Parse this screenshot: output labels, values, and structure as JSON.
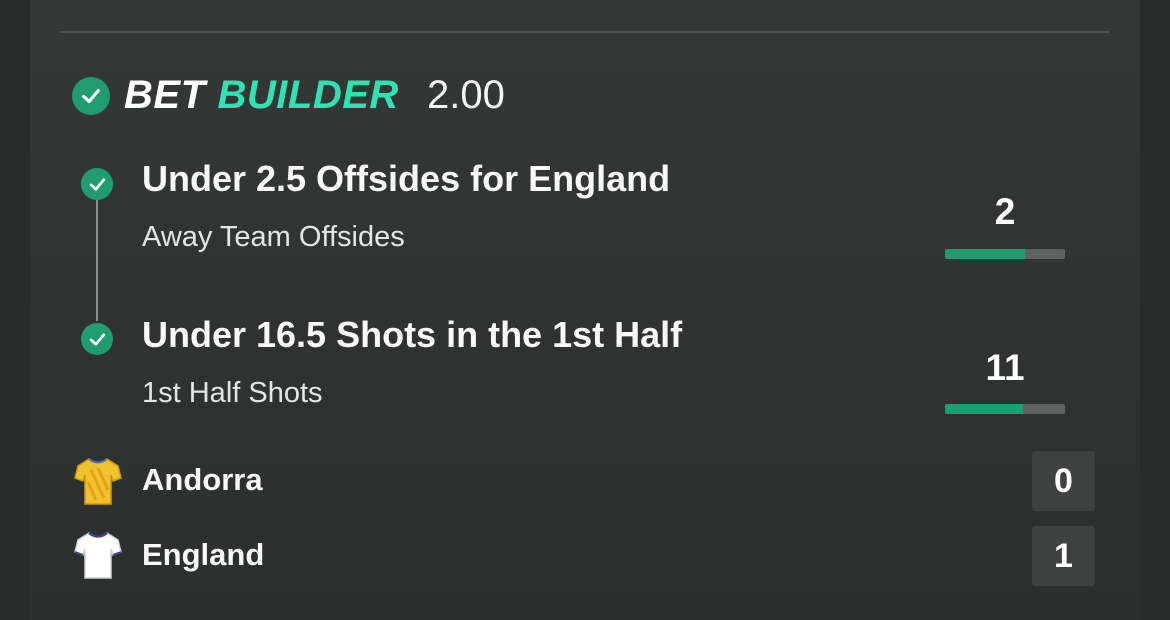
{
  "header": {
    "brand_word1": "BET",
    "brand_word2": "BUILDER",
    "odds": "2.00"
  },
  "selections": [
    {
      "title": "Under 2.5 Offsides for England",
      "subtitle": "Away Team Offsides",
      "stat_value": "2",
      "progress_fraction": 0.67
    },
    {
      "title": "Under 16.5 Shots in the 1st Half",
      "subtitle": "1st Half Shots",
      "stat_value": "11",
      "progress_fraction": 0.65
    }
  ],
  "teams": [
    {
      "name": "Andorra",
      "score": "0",
      "icon": "yellow-shirt-icon"
    },
    {
      "name": "England",
      "score": "1",
      "icon": "white-shirt-icon"
    }
  ],
  "colors": {
    "accent_green": "#1f9d71",
    "brand_teal": "#2ee3b1",
    "background": "#2f3231"
  }
}
